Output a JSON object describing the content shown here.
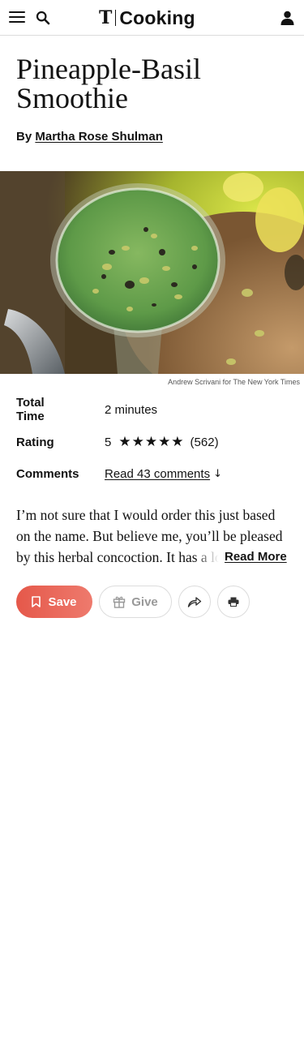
{
  "header": {
    "brand_mark": "T",
    "brand_word": "Cooking",
    "icons": {
      "menu": "hamburger-menu-icon",
      "search": "search-icon",
      "account": "user-icon"
    }
  },
  "recipe": {
    "title": "Pineapple-Basil Smoothie",
    "byline_prefix": "By",
    "author": "Martha Rose Shulman",
    "image_alt": "A glass of green pineapple-basil smoothie topped with chopped pistachios",
    "image_credit": "Andrew Scrivani for The New York Times"
  },
  "facts": {
    "total_time_label": "Total Time",
    "total_time_value": "2 minutes",
    "rating_label": "Rating",
    "rating_value": "5",
    "rating_stars": "★★★★★",
    "rating_count": "(562)",
    "comments_label": "Comments",
    "comments_link": "Read 43 comments",
    "comments_arrow": "↓"
  },
  "description": {
    "text": "I’m not sure that I would order this just based on the name. But believe me, you’ll be pleased by this herbal concoction. It has a lovely, refreshing flavor.",
    "read_more": "Read More"
  },
  "actions": {
    "save_label": "Save",
    "give_label": "Give",
    "share_icon": "share-icon",
    "print_icon": "print-icon"
  },
  "colors": {
    "save_start": "#e5584a",
    "save_end": "#ee7a6d",
    "text": "#121212",
    "muted": "#999999",
    "border": "#dcdcdc"
  }
}
